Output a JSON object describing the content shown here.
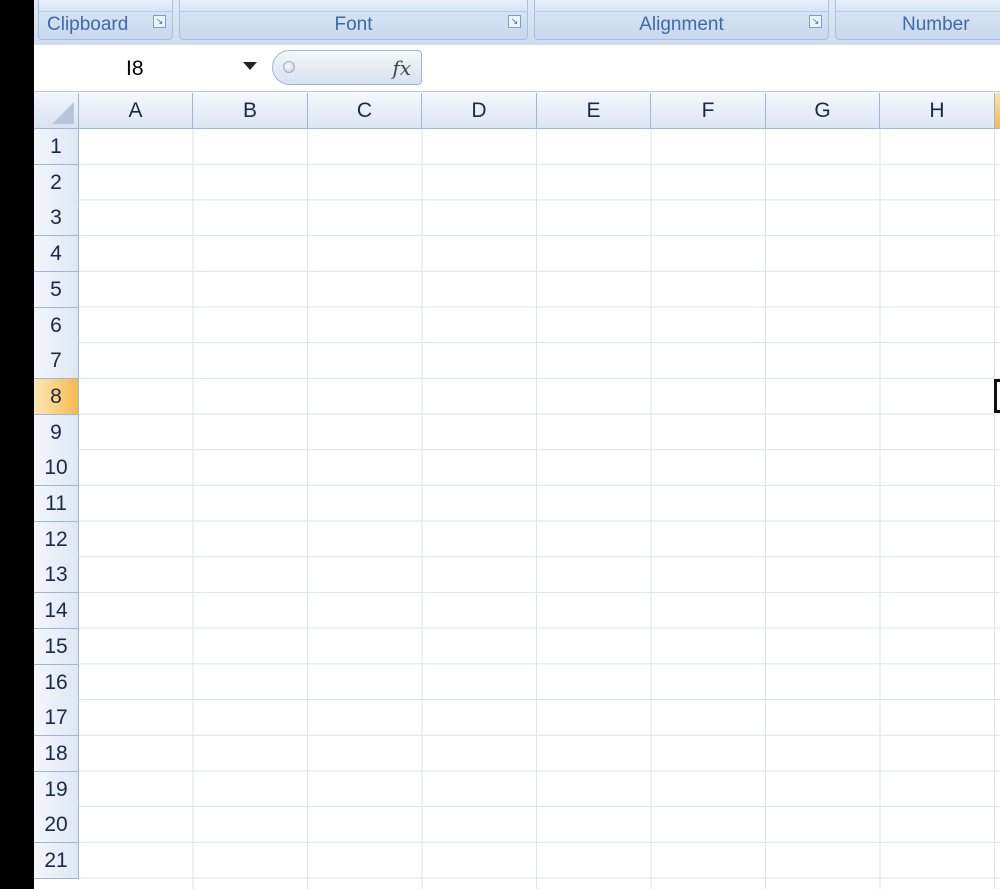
{
  "ribbon": {
    "groups": [
      {
        "label": "Clipboard",
        "launcher": true
      },
      {
        "label": "Font",
        "launcher": true
      },
      {
        "label": "Alignment",
        "launcher": true
      },
      {
        "label": "Number",
        "launcher": false
      }
    ]
  },
  "formula_bar": {
    "name_box_value": "I8",
    "fx_label": "fx",
    "formula_value": ""
  },
  "grid": {
    "columns": [
      "A",
      "B",
      "C",
      "D",
      "E",
      "F",
      "G",
      "H"
    ],
    "rows": [
      "1",
      "2",
      "3",
      "4",
      "5",
      "6",
      "7",
      "8",
      "9",
      "10",
      "11",
      "12",
      "13",
      "14",
      "15",
      "16",
      "17",
      "18",
      "19",
      "20",
      "21"
    ],
    "active_row": "8",
    "active_cell": "I8"
  },
  "colors": {
    "active_header": "#f5b94e",
    "gridline": "#dbe3ef",
    "header_border": "#9fb6d6",
    "ribbon_label": "#3e6aaa"
  }
}
